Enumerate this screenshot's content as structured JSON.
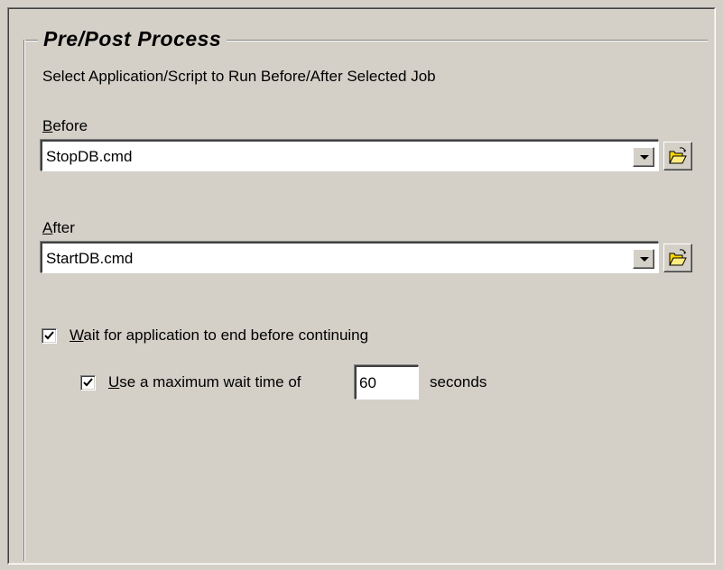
{
  "group": {
    "title": "Pre/Post Process",
    "description": "Select Application/Script to Run Before/After Selected Job"
  },
  "before": {
    "label_accel": "B",
    "label_rest": "efore",
    "value": "StopDB.cmd"
  },
  "after": {
    "label_accel": "A",
    "label_rest": "fter",
    "value": "StartDB.cmd"
  },
  "wait_option": {
    "checked": true,
    "label_accel": "W",
    "label_rest": "ait for application to end before continuing"
  },
  "max_wait_option": {
    "checked": true,
    "label_accel": "U",
    "label_rest": "se a maximum wait time of",
    "value": "60",
    "unit_label": "seconds"
  },
  "icons": {
    "dropdown": "chevron-down-icon",
    "browse": "open-folder-icon",
    "check": "checkmark-icon"
  },
  "colors": {
    "face": "#d4d0c8",
    "shadow": "#808080",
    "dark_shadow": "#404040",
    "highlight": "#ffffff",
    "folder": "#ffd700"
  }
}
